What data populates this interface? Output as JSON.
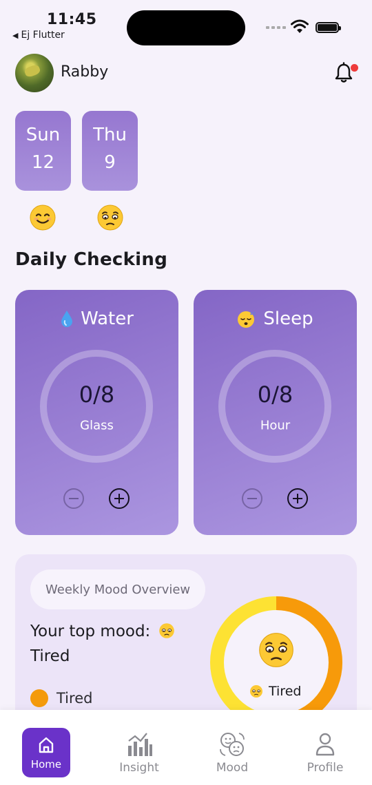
{
  "status_bar": {
    "time": "11:45",
    "back_app": "Ej Flutter"
  },
  "header": {
    "username": "Rabby"
  },
  "dates": [
    {
      "day": "Sun",
      "num": "12",
      "mood": "smile-emoji"
    },
    {
      "day": "Thu",
      "num": "9",
      "mood": "tired-emoji"
    }
  ],
  "daily": {
    "title": "Daily Checking",
    "water": {
      "label": "Water",
      "value": "0/8",
      "unit": "Glass",
      "icon": "droplet-icon"
    },
    "sleep": {
      "label": "Sleep",
      "value": "0/8",
      "unit": "Hour",
      "icon": "sleeping-face-icon"
    }
  },
  "weekly": {
    "pill": "Weekly Mood Overview",
    "top_mood_prefix": "Your top mood:",
    "top_mood_name": "Tired",
    "legend": [
      {
        "label": "Tired",
        "color": "#f49a0b"
      }
    ],
    "donut_label": "Tired",
    "donut_colors": {
      "primary": "#f79a0a",
      "secondary": "#fde233"
    }
  },
  "nav": {
    "home": "Home",
    "insight": "Insight",
    "mood": "Mood",
    "profile": "Profile"
  },
  "colors": {
    "accent": "#6a32c9",
    "card": "#9677d0",
    "notification": "#ee3b3b"
  }
}
